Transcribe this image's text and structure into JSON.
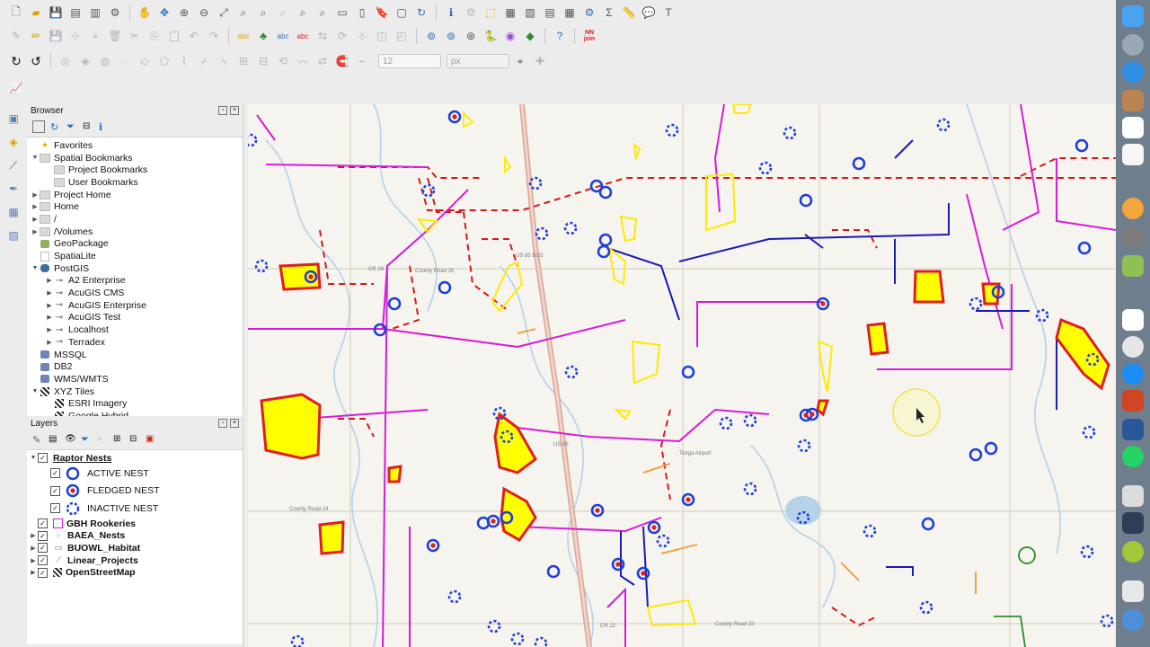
{
  "toolbar": {
    "font_size_value": "12",
    "unit_value": "px",
    "join_badge": "NN join"
  },
  "browser": {
    "title": "Browser",
    "items": [
      {
        "label": "Favorites",
        "indent": 0,
        "arrow": "",
        "icon": "star-icon"
      },
      {
        "label": "Spatial Bookmarks",
        "indent": 0,
        "arrow": "▼",
        "icon": "folder-icon"
      },
      {
        "label": "Project Bookmarks",
        "indent": 1,
        "arrow": "",
        "icon": "folder-icon"
      },
      {
        "label": "User Bookmarks",
        "indent": 1,
        "arrow": "",
        "icon": "folder-icon"
      },
      {
        "label": "Project Home",
        "indent": 0,
        "arrow": "▶",
        "icon": "folder-icon"
      },
      {
        "label": "Home",
        "indent": 0,
        "arrow": "▶",
        "icon": "folder-icon"
      },
      {
        "label": "/",
        "indent": 0,
        "arrow": "▶",
        "icon": "folder-icon"
      },
      {
        "label": "/Volumes",
        "indent": 0,
        "arrow": "▶",
        "icon": "folder-icon"
      },
      {
        "label": "GeoPackage",
        "indent": 0,
        "arrow": "",
        "icon": "geopackage-icon"
      },
      {
        "label": "SpatiaLite",
        "indent": 0,
        "arrow": "",
        "icon": "spatialite-icon"
      },
      {
        "label": "PostGIS",
        "indent": 0,
        "arrow": "▼",
        "icon": "postgis-icon"
      },
      {
        "label": "A2 Enterprise",
        "indent": 1,
        "arrow": "▶",
        "icon": "connection-icon"
      },
      {
        "label": "AcuGIS CMS",
        "indent": 1,
        "arrow": "▶",
        "icon": "connection-icon"
      },
      {
        "label": "AcuGIS Enterprise",
        "indent": 1,
        "arrow": "▶",
        "icon": "connection-icon"
      },
      {
        "label": "AcuGIS Test",
        "indent": 1,
        "arrow": "▶",
        "icon": "connection-icon"
      },
      {
        "label": "Localhost",
        "indent": 1,
        "arrow": "▶",
        "icon": "connection-icon"
      },
      {
        "label": "Terradex",
        "indent": 1,
        "arrow": "▶",
        "icon": "connection-icon"
      },
      {
        "label": "MSSQL",
        "indent": 0,
        "arrow": "",
        "icon": "database-icon"
      },
      {
        "label": "DB2",
        "indent": 0,
        "arrow": "",
        "icon": "database-icon"
      },
      {
        "label": "WMS/WMTS",
        "indent": 0,
        "arrow": "",
        "icon": "globe-icon"
      },
      {
        "label": "XYZ Tiles",
        "indent": 0,
        "arrow": "▼",
        "icon": "tiles-icon"
      },
      {
        "label": "ESRI Imagery",
        "indent": 1,
        "arrow": "",
        "icon": "tiles-icon"
      },
      {
        "label": "Google Hybrid",
        "indent": 1,
        "arrow": "",
        "icon": "tiles-icon"
      }
    ]
  },
  "layers": {
    "title": "Layers",
    "group": "Raptor Nests",
    "classes": [
      "ACTIVE NEST",
      "FLEDGED NEST",
      "INACTIVE NEST"
    ],
    "others": [
      "GBH Rookeries",
      "BAEA_Nests",
      "BUOWL_Habitat",
      "Linear_Projects",
      "OpenStreetMap"
    ]
  },
  "map": {
    "road_labels": [
      "US 85 BUS",
      "CR 28",
      "County Road 28",
      "County Road 24",
      "CR 22",
      "County Road 22",
      "US 85",
      "Tonga Airport"
    ]
  },
  "colors": {
    "nest_blue": "#1f3fd6",
    "fledged_red": "#e01e1e",
    "habitat_yellow": "#ffff00",
    "project_magenta": "#d81bd8",
    "project_navy": "#1a1ab5",
    "boundary_red": "#d81818"
  }
}
